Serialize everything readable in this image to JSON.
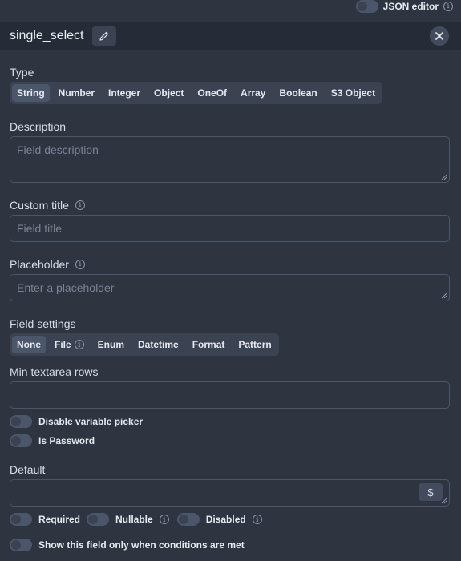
{
  "json_editor": {
    "label": "JSON editor"
  },
  "header": {
    "field_name": "single_select"
  },
  "type_section": {
    "label": "Type",
    "options": [
      "String",
      "Number",
      "Integer",
      "Object",
      "OneOf",
      "Array",
      "Boolean",
      "S3 Object"
    ],
    "selected": "String"
  },
  "description": {
    "label": "Description",
    "placeholder": "Field description"
  },
  "custom_title": {
    "label": "Custom title",
    "placeholder": "Field title"
  },
  "placeholder_field": {
    "label": "Placeholder",
    "placeholder": "Enter a placeholder"
  },
  "field_settings": {
    "label": "Field settings",
    "options": [
      "None",
      "File",
      "Enum",
      "Datetime",
      "Format",
      "Pattern"
    ],
    "selected": "None"
  },
  "min_textarea_rows": {
    "label": "Min textarea rows",
    "value": ""
  },
  "toggles": {
    "disable_variable_picker": "Disable variable picker",
    "is_password": "Is Password"
  },
  "default_field": {
    "label": "Default",
    "value": "",
    "dollar_label": "$"
  },
  "flags": {
    "required": "Required",
    "nullable": "Nullable",
    "disabled": "Disabled"
  },
  "conditions": {
    "label": "Show this field only when conditions are met"
  }
}
